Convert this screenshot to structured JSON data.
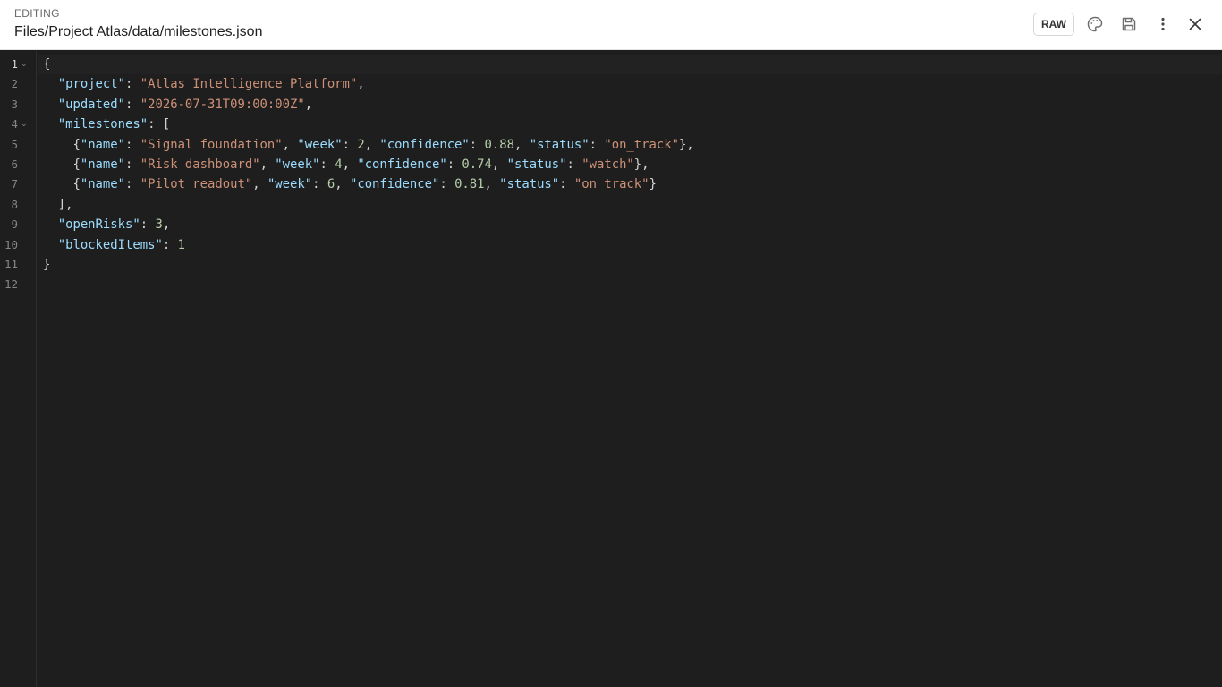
{
  "header": {
    "mode_label": "EDITING",
    "file_path": "Files/Project Atlas/data/milestones.json",
    "raw_label": "RAW"
  },
  "icons": {
    "palette": "palette-icon",
    "save": "save-icon",
    "more": "more-vertical-icon",
    "close": "close-icon",
    "fold": "chevron-down-icon"
  },
  "colors": {
    "editor_bg": "#1e1e1e",
    "key": "#9cdcfe",
    "string": "#ce9178",
    "number": "#b5cea8",
    "punctuation": "#d4d4d4",
    "line_number": "#858585"
  },
  "editor": {
    "active_line": 1,
    "lines": [
      {
        "n": "1",
        "fold": true,
        "tokens": [
          {
            "t": "p",
            "v": "{"
          }
        ]
      },
      {
        "n": "2",
        "tokens": [
          {
            "t": "p",
            "v": "  "
          },
          {
            "t": "k",
            "v": "\"project\""
          },
          {
            "t": "p",
            "v": ": "
          },
          {
            "t": "s",
            "v": "\"Atlas Intelligence Platform\""
          },
          {
            "t": "p",
            "v": ","
          }
        ]
      },
      {
        "n": "3",
        "tokens": [
          {
            "t": "p",
            "v": "  "
          },
          {
            "t": "k",
            "v": "\"updated\""
          },
          {
            "t": "p",
            "v": ": "
          },
          {
            "t": "s",
            "v": "\"2026-07-31T09:00:00Z\""
          },
          {
            "t": "p",
            "v": ","
          }
        ]
      },
      {
        "n": "4",
        "fold": true,
        "tokens": [
          {
            "t": "p",
            "v": "  "
          },
          {
            "t": "k",
            "v": "\"milestones\""
          },
          {
            "t": "p",
            "v": ": ["
          }
        ]
      },
      {
        "n": "5",
        "tokens": [
          {
            "t": "p",
            "v": "    {"
          },
          {
            "t": "k",
            "v": "\"name\""
          },
          {
            "t": "p",
            "v": ": "
          },
          {
            "t": "s",
            "v": "\"Signal foundation\""
          },
          {
            "t": "p",
            "v": ", "
          },
          {
            "t": "k",
            "v": "\"week\""
          },
          {
            "t": "p",
            "v": ": "
          },
          {
            "t": "n",
            "v": "2"
          },
          {
            "t": "p",
            "v": ", "
          },
          {
            "t": "k",
            "v": "\"confidence\""
          },
          {
            "t": "p",
            "v": ": "
          },
          {
            "t": "n",
            "v": "0.88"
          },
          {
            "t": "p",
            "v": ", "
          },
          {
            "t": "k",
            "v": "\"status\""
          },
          {
            "t": "p",
            "v": ": "
          },
          {
            "t": "s",
            "v": "\"on_track\""
          },
          {
            "t": "p",
            "v": "},"
          }
        ]
      },
      {
        "n": "6",
        "tokens": [
          {
            "t": "p",
            "v": "    {"
          },
          {
            "t": "k",
            "v": "\"name\""
          },
          {
            "t": "p",
            "v": ": "
          },
          {
            "t": "s",
            "v": "\"Risk dashboard\""
          },
          {
            "t": "p",
            "v": ", "
          },
          {
            "t": "k",
            "v": "\"week\""
          },
          {
            "t": "p",
            "v": ": "
          },
          {
            "t": "n",
            "v": "4"
          },
          {
            "t": "p",
            "v": ", "
          },
          {
            "t": "k",
            "v": "\"confidence\""
          },
          {
            "t": "p",
            "v": ": "
          },
          {
            "t": "n",
            "v": "0.74"
          },
          {
            "t": "p",
            "v": ", "
          },
          {
            "t": "k",
            "v": "\"status\""
          },
          {
            "t": "p",
            "v": ": "
          },
          {
            "t": "s",
            "v": "\"watch\""
          },
          {
            "t": "p",
            "v": "},"
          }
        ]
      },
      {
        "n": "7",
        "tokens": [
          {
            "t": "p",
            "v": "    {"
          },
          {
            "t": "k",
            "v": "\"name\""
          },
          {
            "t": "p",
            "v": ": "
          },
          {
            "t": "s",
            "v": "\"Pilot readout\""
          },
          {
            "t": "p",
            "v": ", "
          },
          {
            "t": "k",
            "v": "\"week\""
          },
          {
            "t": "p",
            "v": ": "
          },
          {
            "t": "n",
            "v": "6"
          },
          {
            "t": "p",
            "v": ", "
          },
          {
            "t": "k",
            "v": "\"confidence\""
          },
          {
            "t": "p",
            "v": ": "
          },
          {
            "t": "n",
            "v": "0.81"
          },
          {
            "t": "p",
            "v": ", "
          },
          {
            "t": "k",
            "v": "\"status\""
          },
          {
            "t": "p",
            "v": ": "
          },
          {
            "t": "s",
            "v": "\"on_track\""
          },
          {
            "t": "p",
            "v": "}"
          }
        ]
      },
      {
        "n": "8",
        "tokens": [
          {
            "t": "p",
            "v": "  ],"
          }
        ]
      },
      {
        "n": "9",
        "tokens": [
          {
            "t": "p",
            "v": "  "
          },
          {
            "t": "k",
            "v": "\"openRisks\""
          },
          {
            "t": "p",
            "v": ": "
          },
          {
            "t": "n",
            "v": "3"
          },
          {
            "t": "p",
            "v": ","
          }
        ]
      },
      {
        "n": "10",
        "tokens": [
          {
            "t": "p",
            "v": "  "
          },
          {
            "t": "k",
            "v": "\"blockedItems\""
          },
          {
            "t": "p",
            "v": ": "
          },
          {
            "t": "n",
            "v": "1"
          }
        ]
      },
      {
        "n": "11",
        "tokens": [
          {
            "t": "p",
            "v": "}"
          }
        ]
      },
      {
        "n": "12",
        "tokens": []
      }
    ]
  }
}
